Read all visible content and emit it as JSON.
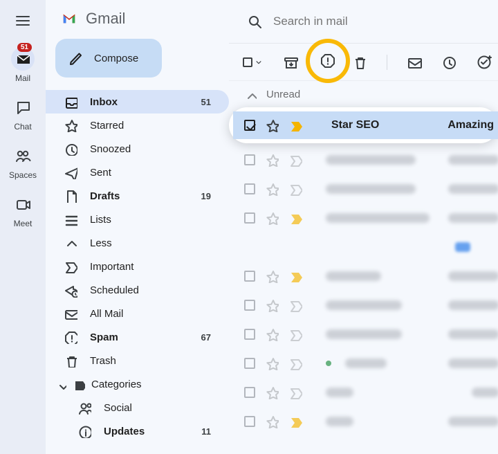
{
  "app": {
    "name": "Gmail"
  },
  "search": {
    "placeholder": "Search in mail"
  },
  "rail": {
    "mail": {
      "label": "Mail",
      "badge": "51"
    },
    "chat": {
      "label": "Chat"
    },
    "spaces": {
      "label": "Spaces"
    },
    "meet": {
      "label": "Meet"
    }
  },
  "compose": {
    "label": "Compose"
  },
  "folders": {
    "inbox": {
      "label": "Inbox",
      "count": "51"
    },
    "starred": {
      "label": "Starred"
    },
    "snoozed": {
      "label": "Snoozed"
    },
    "sent": {
      "label": "Sent"
    },
    "drafts": {
      "label": "Drafts",
      "count": "19"
    },
    "lists": {
      "label": "Lists"
    },
    "less": {
      "label": "Less"
    },
    "important": {
      "label": "Important"
    },
    "scheduled": {
      "label": "Scheduled"
    },
    "allmail": {
      "label": "All Mail"
    },
    "spam": {
      "label": "Spam",
      "count": "67"
    },
    "trash": {
      "label": "Trash"
    },
    "categories": {
      "label": "Categories"
    },
    "social": {
      "label": "Social"
    },
    "updates": {
      "label": "Updates",
      "count": "11"
    }
  },
  "section": {
    "unread": "Unread"
  },
  "selected_email": {
    "sender": "Star SEO",
    "subject": "Amazing"
  }
}
